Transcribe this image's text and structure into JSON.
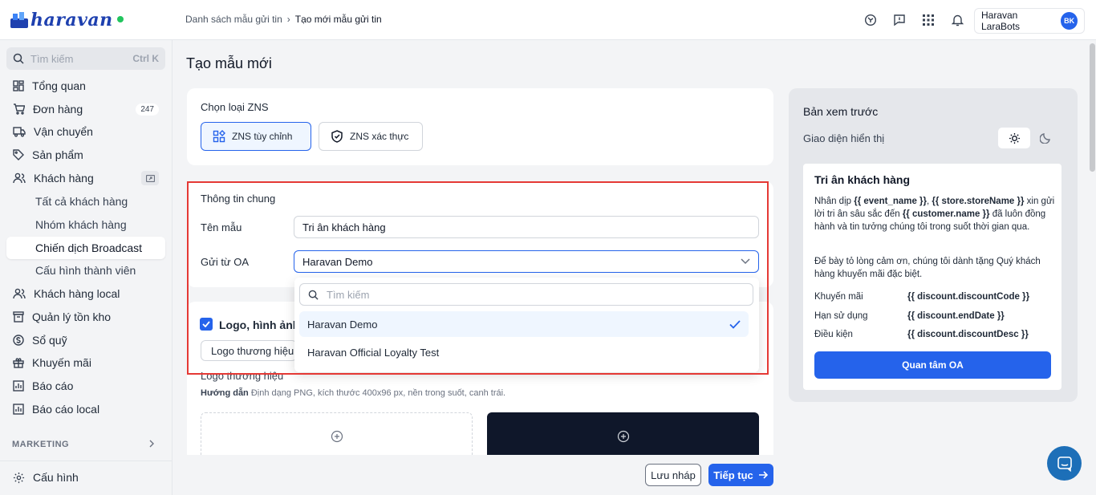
{
  "brand": {
    "name": "haravan",
    "accent": "#2563eb",
    "online": "#22c55e"
  },
  "breadcrumb": {
    "parent": "Danh sách mẫu gửi tin",
    "separator": "›",
    "current": "Tạo mới mẫu gửi tin"
  },
  "header": {
    "icons": [
      "globe-icon",
      "feedback-icon",
      "apps-grid-icon",
      "bell-icon"
    ],
    "account_name": "Haravan LaraBots",
    "account_initials": "BK"
  },
  "sidebar": {
    "search_placeholder": "Tìm kiếm",
    "search_shortcut": "Ctrl K",
    "items": [
      {
        "label": "Tổng quan",
        "icon": "dashboard-icon"
      },
      {
        "label": "Đơn hàng",
        "icon": "cart-icon",
        "badge": "247"
      },
      {
        "label": "Vận chuyển",
        "icon": "truck-icon"
      },
      {
        "label": "Sản phẩm",
        "icon": "tag-icon"
      },
      {
        "label": "Khách hàng",
        "icon": "users-icon"
      }
    ],
    "sub_items": [
      "Tất cả khách hàng",
      "Nhóm khách hàng",
      "Chiến dịch Broadcast",
      "Cấu hình thành viên"
    ],
    "items2": [
      {
        "label": "Khách hàng local",
        "icon": "users-icon"
      },
      {
        "label": "Quản lý tồn kho",
        "icon": "inventory-icon"
      },
      {
        "label": "Sổ quỹ",
        "icon": "cash-icon"
      },
      {
        "label": "Khuyến mãi",
        "icon": "gift-icon"
      },
      {
        "label": "Báo cáo",
        "icon": "chart-icon"
      },
      {
        "label": "Báo cáo local",
        "icon": "chart-icon"
      }
    ],
    "section": "MARKETING",
    "settings": "Cấu hình"
  },
  "main": {
    "title": "Tạo mẫu mới",
    "zns": {
      "label": "Chọn loại ZNS",
      "custom": "ZNS tùy chỉnh",
      "verified": "ZNS xác thực"
    },
    "general": {
      "heading": "Thông tin chung",
      "name_label": "Tên mẫu",
      "name_value": "Tri ân khách hàng",
      "oa_label": "Gửi từ OA",
      "oa_value": "Haravan Demo"
    },
    "dropdown": {
      "search_placeholder": "Tìm kiếm",
      "options": [
        "Haravan Demo",
        "Haravan Official Loyalty Test"
      ]
    },
    "logo": {
      "checkbox_label": "Logo, hình ảnh",
      "tab": "Logo thương hiệu",
      "heading": "Logo thương hiệu",
      "hint_bold": "Hướng dẫn",
      "hint": "Định dạng PNG, kích thước 400x96 px, nền trong suốt, canh trái."
    },
    "save_draft": "Lưu nháp",
    "continue": "Tiếp tục"
  },
  "preview": {
    "heading": "Bản xem trước",
    "theme_label": "Giao diện hiển thị",
    "card_title": "Tri ân khách hàng",
    "p1_a": "Nhân dịp ",
    "p1_b": "{{ event_name }}",
    "p1_c": ", ",
    "p1_d": "{{ store.storeName }}",
    "p1_e": " xin gửi lời tri ân sâu sắc đến ",
    "p1_f": "{{ customer.name }}",
    "p1_g": " đã luôn đồng hành và tin tưởng chúng tôi trong suốt thời gian qua.",
    "p2": "Để bày tỏ lòng cảm ơn, chúng tôi dành tặng Quý khách hàng khuyến mãi đặc biệt.",
    "rows": [
      {
        "label": "Khuyến mãi",
        "value": "{{ discount.discountCode }}"
      },
      {
        "label": "Hạn sử dụng",
        "value": "{{ discount.endDate }}"
      },
      {
        "label": "Điều kiện",
        "value": "{{ discount.discountDesc }}"
      }
    ],
    "button": "Quan tâm OA"
  }
}
